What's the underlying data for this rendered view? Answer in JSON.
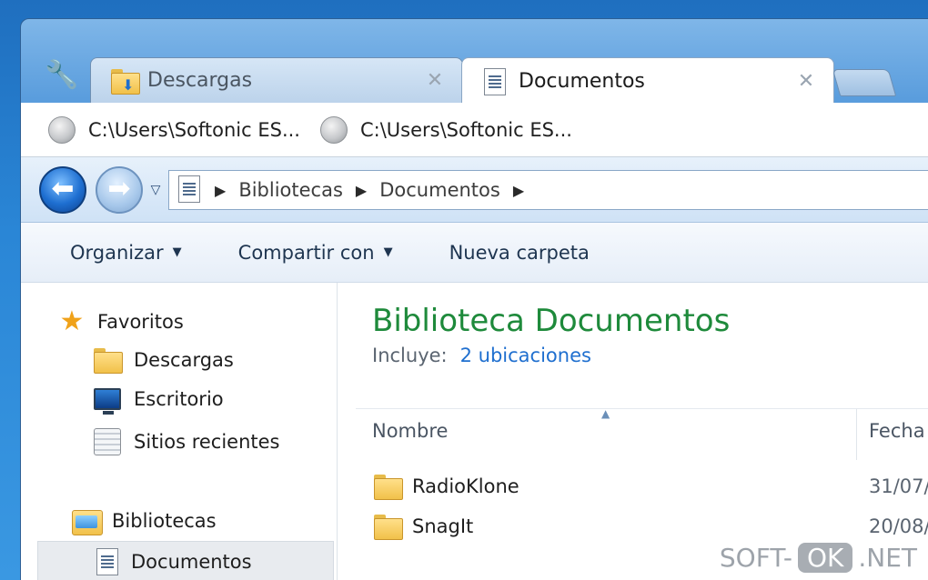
{
  "browser": {
    "tabs": [
      {
        "label": "Descargas",
        "active": false,
        "icon": "downloads-folder-icon"
      },
      {
        "label": "Documentos",
        "active": true,
        "icon": "document-icon"
      }
    ],
    "close_glyph": "✕",
    "bookmarks": [
      {
        "label": "C:\\Users\\Softonic ES..."
      },
      {
        "label": "C:\\Users\\Softonic ES..."
      }
    ]
  },
  "explorer": {
    "breadcrumb": [
      "Bibliotecas",
      "Documentos"
    ],
    "commands": [
      {
        "label": "Organizar",
        "has_menu": true
      },
      {
        "label": "Compartir con",
        "has_menu": true
      },
      {
        "label": "Nueva carpeta",
        "has_menu": false
      }
    ],
    "nav": {
      "favorites_label": "Favoritos",
      "favorites": [
        "Descargas",
        "Escritorio",
        "Sitios recientes"
      ],
      "libraries_label": "Bibliotecas",
      "libraries": [
        "Documentos"
      ]
    },
    "library": {
      "title": "Biblioteca Documentos",
      "includes_label": "Incluye:",
      "includes_value": "2 ubicaciones"
    },
    "columns": {
      "name": "Nombre",
      "date": "Fecha"
    },
    "files": [
      {
        "name": "RadioKlone",
        "date": "31/07/"
      },
      {
        "name": "SnagIt",
        "date": "20/08/"
      }
    ]
  },
  "watermark": {
    "prefix": "SOFT-",
    "mid": "OK",
    "suffix": ".NET"
  },
  "colors": {
    "accent_green": "#1e8a3b",
    "link_blue": "#1f6fcf",
    "window_blue": "#4f94d8"
  }
}
